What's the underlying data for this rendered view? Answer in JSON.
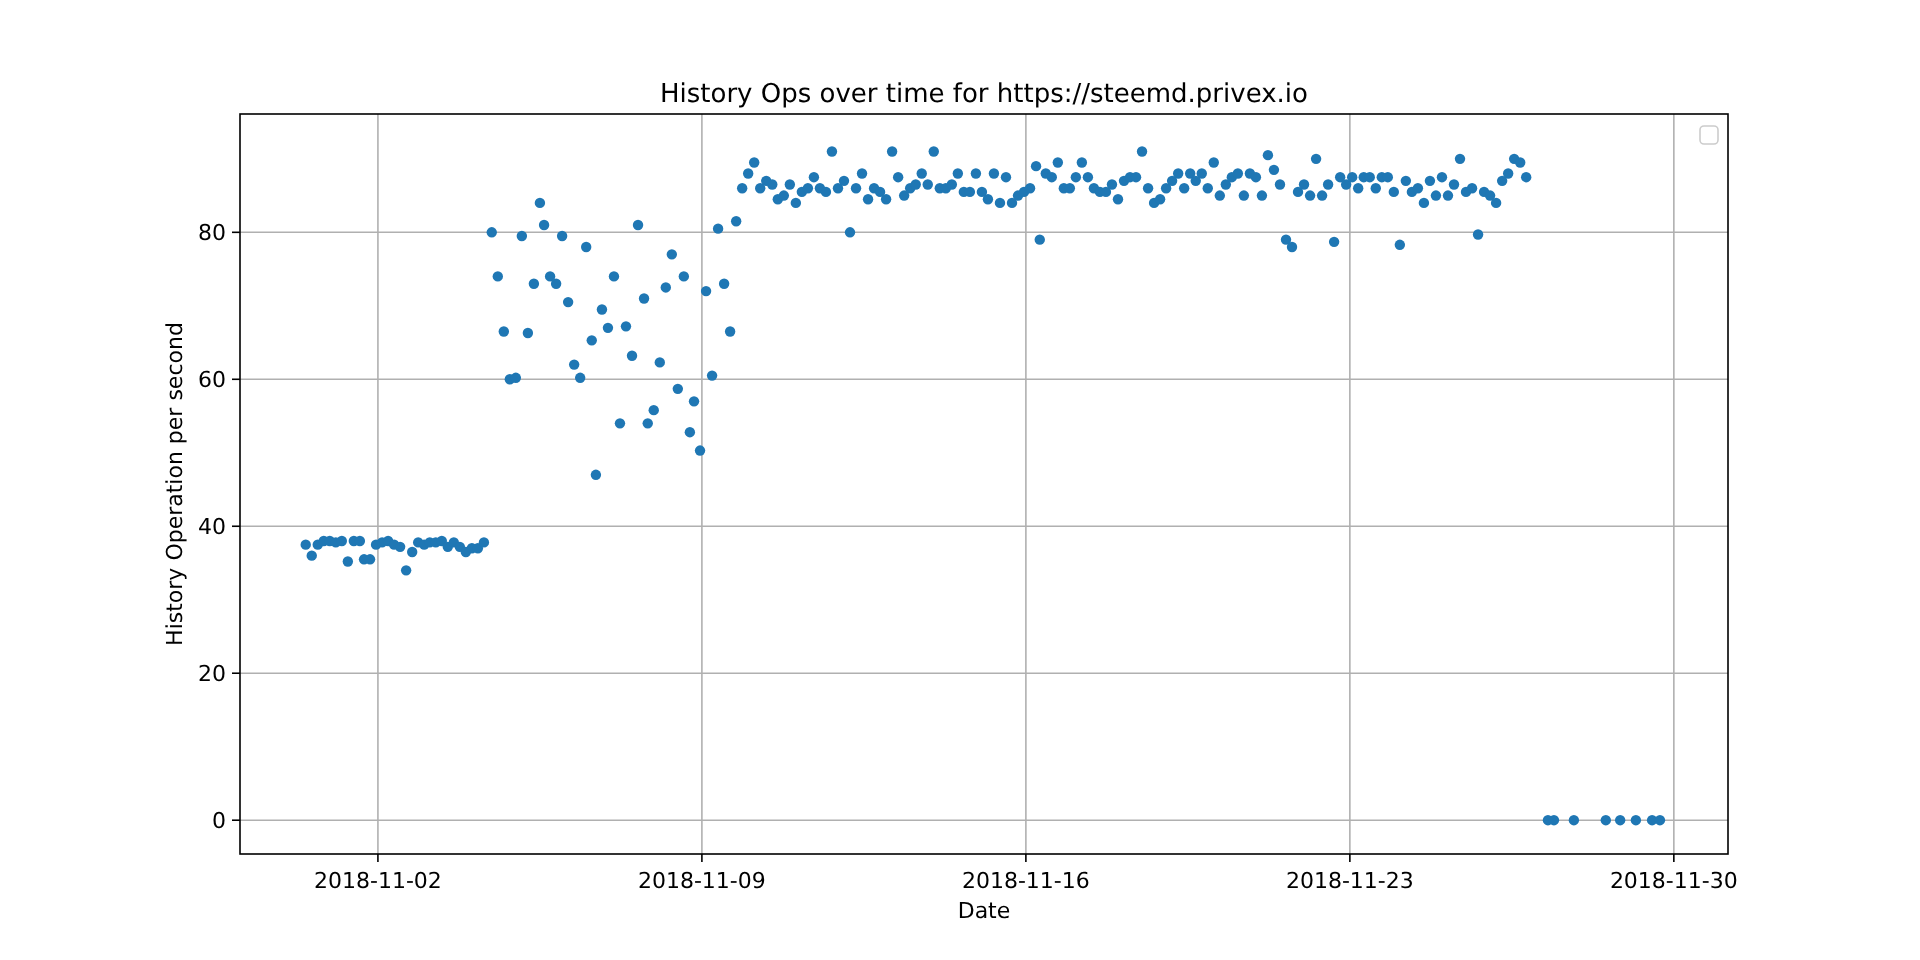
{
  "figure": {
    "chart_data": {
      "type": "scatter",
      "title": "History Ops over time for https://steemd.privex.io",
      "xlabel": "Date",
      "ylabel": "History Operation per second",
      "xlim": [
        "2018-10-30T00:29",
        "2018-12-01T04:05"
      ],
      "ylim": [
        -4.6,
        96.1
      ],
      "xticks": [
        {
          "value": "2018-11-02",
          "label": "2018-11-02"
        },
        {
          "value": "2018-11-09",
          "label": "2018-11-09"
        },
        {
          "value": "2018-11-16",
          "label": "2018-11-16"
        },
        {
          "value": "2018-11-23",
          "label": "2018-11-23"
        },
        {
          "value": "2018-11-30",
          "label": "2018-11-30"
        }
      ],
      "yticks": [
        0,
        20,
        40,
        60,
        80
      ],
      "grid": true,
      "x": [
        "2018-10-31T10:34",
        "2018-10-31T13:41",
        "2018-10-31T16:48",
        "2018-10-31T19:55",
        "2018-10-31T23:02",
        "2018-11-01T02:10",
        "2018-11-01T05:17",
        "2018-11-01T08:24",
        "2018-11-01T11:31",
        "2018-11-01T14:38",
        "2018-11-01T16:48",
        "2018-11-01T19:55",
        "2018-11-01T23:02",
        "2018-11-02T02:10",
        "2018-11-02T05:17",
        "2018-11-02T08:24",
        "2018-11-02T11:31",
        "2018-11-02T14:38",
        "2018-11-02T17:46",
        "2018-11-02T20:53",
        "2018-11-03T00:00",
        "2018-11-03T02:53",
        "2018-11-03T06:00",
        "2018-11-03T09:07",
        "2018-11-03T12:14",
        "2018-11-03T15:22",
        "2018-11-03T18:29",
        "2018-11-03T21:36",
        "2018-11-04T00:43",
        "2018-11-04T03:50",
        "2018-11-04T06:58",
        "2018-11-04T11:02",
        "2018-11-04T14:10",
        "2018-11-04T17:17",
        "2018-11-04T20:24",
        "2018-11-04T23:31",
        "2018-11-05T02:38",
        "2018-11-05T05:46",
        "2018-11-05T08:53",
        "2018-11-05T12:00",
        "2018-11-05T14:10",
        "2018-11-05T17:17",
        "2018-11-05T20:24",
        "2018-11-05T23:31",
        "2018-11-06T02:38",
        "2018-11-06T05:46",
        "2018-11-06T08:53",
        "2018-11-06T12:00",
        "2018-11-06T14:53",
        "2018-11-06T17:02",
        "2018-11-06T20:10",
        "2018-11-06T23:17",
        "2018-11-07T02:24",
        "2018-11-07T05:31",
        "2018-11-07T08:38",
        "2018-11-07T11:46",
        "2018-11-07T14:53",
        "2018-11-07T18:00",
        "2018-11-07T19:55",
        "2018-11-07T23:02",
        "2018-11-08T02:10",
        "2018-11-08T05:17",
        "2018-11-08T08:24",
        "2018-11-08T11:31",
        "2018-11-08T14:38",
        "2018-11-08T17:46",
        "2018-11-08T19:55",
        "2018-11-08T23:02",
        "2018-11-09T02:10",
        "2018-11-09T05:17",
        "2018-11-09T08:24",
        "2018-11-09T11:31",
        "2018-11-09T14:38",
        "2018-11-09T17:46",
        "2018-11-09T20:53",
        "2018-11-10T00:00",
        "2018-11-10T03:07",
        "2018-11-10T06:14",
        "2018-11-10T09:22",
        "2018-11-10T12:29",
        "2018-11-10T15:22",
        "2018-11-10T18:29",
        "2018-11-10T21:36",
        "2018-11-11T00:43",
        "2018-11-11T03:50",
        "2018-11-11T06:58",
        "2018-11-11T10:05",
        "2018-11-11T13:12",
        "2018-11-11T16:19",
        "2018-11-11T19:26",
        "2018-11-11T22:34",
        "2018-11-12T01:41",
        "2018-11-12T04:48",
        "2018-11-12T07:55",
        "2018-11-12T11:02",
        "2018-11-12T14:10",
        "2018-11-12T17:17",
        "2018-11-12T20:24",
        "2018-11-12T23:31",
        "2018-11-13T02:38",
        "2018-11-13T05:46",
        "2018-11-13T08:53",
        "2018-11-13T12:00",
        "2018-11-13T14:53",
        "2018-11-13T18:00",
        "2018-11-13T21:07",
        "2018-11-14T00:14",
        "2018-11-14T03:22",
        "2018-11-14T06:29",
        "2018-11-14T09:36",
        "2018-11-14T12:43",
        "2018-11-14T15:50",
        "2018-11-14T18:58",
        "2018-11-14T22:05",
        "2018-11-15T01:12",
        "2018-11-15T04:19",
        "2018-11-15T07:26",
        "2018-11-15T10:34",
        "2018-11-15T13:41",
        "2018-11-15T16:48",
        "2018-11-15T19:55",
        "2018-11-15T23:02",
        "2018-11-16T02:10",
        "2018-11-16T05:17",
        "2018-11-16T07:12",
        "2018-11-16T10:19",
        "2018-11-16T13:26",
        "2018-11-16T16:34",
        "2018-11-16T19:41",
        "2018-11-16T22:48",
        "2018-11-17T01:55",
        "2018-11-17T05:02",
        "2018-11-17T08:10",
        "2018-11-17T11:17",
        "2018-11-17T14:24",
        "2018-11-17T17:31",
        "2018-11-17T20:38",
        "2018-11-17T23:46",
        "2018-11-18T02:53",
        "2018-11-18T06:00",
        "2018-11-18T09:07",
        "2018-11-18T12:14",
        "2018-11-18T15:22",
        "2018-11-18T18:29",
        "2018-11-18T21:36",
        "2018-11-19T00:43",
        "2018-11-19T03:50",
        "2018-11-19T06:58",
        "2018-11-19T10:05",
        "2018-11-19T13:12",
        "2018-11-19T16:05",
        "2018-11-19T19:12",
        "2018-11-19T22:19",
        "2018-11-20T01:26",
        "2018-11-20T04:34",
        "2018-11-20T07:41",
        "2018-11-20T10:48",
        "2018-11-20T13:55",
        "2018-11-20T17:02",
        "2018-11-20T20:10",
        "2018-11-20T23:17",
        "2018-11-21T02:24",
        "2018-11-21T05:31",
        "2018-11-21T08:38",
        "2018-11-21T11:46",
        "2018-11-21T14:53",
        "2018-11-21T18:00",
        "2018-11-21T21:07",
        "2018-11-22T00:14",
        "2018-11-22T03:22",
        "2018-11-22T06:29",
        "2018-11-22T09:36",
        "2018-11-22T12:43",
        "2018-11-22T15:50",
        "2018-11-22T18:58",
        "2018-11-22T22:05",
        "2018-11-23T01:12",
        "2018-11-23T04:19",
        "2018-11-23T07:12",
        "2018-11-23T10:19",
        "2018-11-23T13:26",
        "2018-11-23T16:34",
        "2018-11-23T19:41",
        "2018-11-23T22:48",
        "2018-11-24T01:55",
        "2018-11-24T05:02",
        "2018-11-24T08:10",
        "2018-11-24T11:17",
        "2018-11-24T14:24",
        "2018-11-24T17:31",
        "2018-11-24T20:38",
        "2018-11-24T23:46",
        "2018-11-25T02:53",
        "2018-11-25T06:00",
        "2018-11-25T09:07",
        "2018-11-25T12:14",
        "2018-11-25T15:22",
        "2018-11-25T18:29",
        "2018-11-25T21:36",
        "2018-11-26T00:43",
        "2018-11-26T03:50",
        "2018-11-26T06:58",
        "2018-11-26T10:05",
        "2018-11-26T13:12",
        "2018-11-26T16:19",
        "2018-11-26T19:26",
        "2018-11-27T06:43",
        "2018-11-27T09:50",
        "2018-11-27T20:10",
        "2018-11-28T12:43",
        "2018-11-28T20:10",
        "2018-11-29T04:19",
        "2018-11-29T12:43",
        "2018-11-29T16:48"
      ],
      "series": [
        {
          "color": "#1f77b4",
          "values": [
            37.5,
            36,
            37.5,
            38,
            38,
            37.8,
            38,
            35.2,
            38,
            38,
            35.5,
            35.5,
            37.5,
            37.8,
            38,
            37.5,
            37.2,
            34,
            36.5,
            37.8,
            37.5,
            37.8,
            37.8,
            38,
            37.2,
            37.8,
            37.2,
            36.5,
            37,
            37,
            37.8,
            80,
            74,
            66.5,
            60,
            60.2,
            79.5,
            66.3,
            73,
            84,
            81,
            74,
            73,
            79.5,
            70.5,
            62,
            60.2,
            78,
            65.3,
            47,
            69.5,
            67,
            74,
            54,
            67.2,
            63.2,
            81,
            71,
            54,
            55.8,
            62.3,
            72.5,
            77,
            58.7,
            74,
            52.8,
            57,
            50.3,
            72,
            60.5,
            80.5,
            73,
            66.5,
            81.5,
            86,
            88,
            89.5,
            86,
            87,
            86.5,
            84.5,
            85,
            86.5,
            84,
            85.5,
            86,
            87.5,
            86,
            85.5,
            91,
            86,
            87,
            80,
            86,
            88,
            84.5,
            86,
            85.5,
            84.5,
            91,
            87.5,
            85,
            86,
            86.5,
            88,
            86.5,
            91,
            86,
            86,
            86.5,
            88,
            85.5,
            85.5,
            88,
            85.5,
            84.5,
            88,
            84,
            87.5,
            84,
            85,
            85.5,
            86,
            89,
            79,
            88,
            87.5,
            89.5,
            86,
            86,
            87.5,
            89.5,
            87.5,
            86,
            85.5,
            85.5,
            86.5,
            84.5,
            87,
            87.5,
            87.5,
            91,
            86,
            84,
            84.5,
            86,
            87,
            88,
            86,
            88,
            87,
            88,
            86,
            89.5,
            85,
            86.5,
            87.5,
            88,
            85,
            88,
            87.5,
            85,
            90.5,
            88.5,
            86.5,
            79,
            78,
            85.5,
            86.5,
            85,
            90,
            85,
            86.5,
            78.7,
            87.5,
            86.5,
            87.5,
            86,
            87.5,
            87.5,
            86,
            87.5,
            87.5,
            85.5,
            78.3,
            87,
            85.5,
            86,
            84,
            87,
            85,
            87.5,
            85,
            86.5,
            90,
            85.5,
            86,
            79.7,
            85.5,
            85,
            84,
            87,
            88,
            90,
            89.5,
            87.5,
            0,
            0,
            0,
            0,
            0,
            0,
            0,
            0
          ]
        }
      ]
    }
  }
}
